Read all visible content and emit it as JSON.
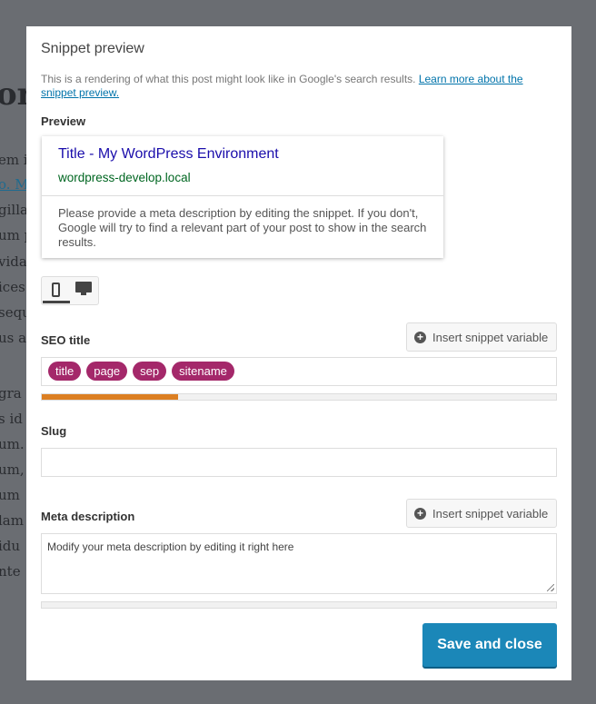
{
  "background": {
    "fragments": [
      "or",
      "em i",
      "o. M",
      "gilla",
      "um p",
      "vida",
      "ices",
      "sequ",
      "us a",
      "gra",
      "s id",
      "um.",
      "um,",
      "um",
      "lam",
      "idu",
      "nte"
    ]
  },
  "modal": {
    "title": "Snippet preview",
    "description": "This is a rendering of what this post might look like in Google's search results. ",
    "learn_more_link": "Learn more about the snippet preview.",
    "preview_label": "Preview",
    "preview": {
      "title": "Title - My WordPress Environment",
      "url": "wordpress-develop.local",
      "description": "Please provide a meta description by editing the snippet. If you don't, Google will try to find a relevant part of your post to show in the search results."
    },
    "device_toggle": {
      "selected": "mobile",
      "options": [
        "mobile-icon",
        "desktop-icon"
      ]
    },
    "seo_title": {
      "label": "SEO title",
      "insert_button": "Insert snippet variable",
      "variables": [
        "title",
        "page",
        "sep",
        "sitename"
      ],
      "progress_percent": 26.5,
      "progress_color": "#dc7f22"
    },
    "slug": {
      "label": "Slug",
      "value": ""
    },
    "meta_description": {
      "label": "Meta description",
      "insert_button": "Insert snippet variable",
      "placeholder": "Modify your meta description by editing it right here",
      "progress_percent": 0
    },
    "save_button": "Save and close",
    "accent_color": "#1b87b8",
    "variable_color": "#a4286a"
  }
}
